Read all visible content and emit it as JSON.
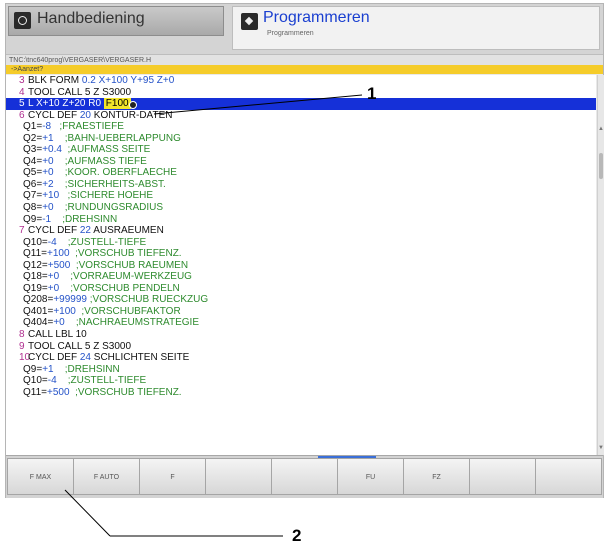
{
  "header": {
    "mode_left": {
      "label": "Handbediening",
      "icon": "manual-mode-icon"
    },
    "mode_right": {
      "label": "Programmeren",
      "sublabel": "Programmeren",
      "icon": "program-mode-icon"
    }
  },
  "pathbar": {
    "path": "TNC:\\tnc640prog\\VERGASER\\VERGASER.H"
  },
  "search": {
    "text": "->Aanzet?"
  },
  "program": {
    "l0": {
      "num": "3",
      "a": "BLK FORM ",
      "b": "0.2",
      "c": " X+100",
      "d": " Y+95",
      "e": " Z+0"
    },
    "l1": {
      "num": "4",
      "a": "TOOL CALL 5 Z S3000"
    },
    "l2": {
      "num": "5",
      "a": "L X+10 Z+20 R0 ",
      "hl": "F100"
    },
    "l3": {
      "num": "6",
      "a": "CYCL DEF ",
      "b": "20",
      "c": " KONTUR-DATEN"
    },
    "l4": {
      "a": "Q1=",
      "b": "-8",
      "c": "   ;FRAESTIEFE"
    },
    "l5": {
      "a": "Q2=",
      "b": "+1",
      "c": "    ;BAHN-UEBERLAPPUNG"
    },
    "l6": {
      "a": "Q3=",
      "b": "+0.4",
      "c": "  ;AUFMASS SEITE"
    },
    "l7": {
      "a": "Q4=",
      "b": "+0",
      "c": "    ;AUFMASS TIEFE"
    },
    "l8": {
      "a": "Q5=",
      "b": "+0",
      "c": "    ;KOOR. OBERFLAECHE"
    },
    "l9": {
      "a": "Q6=",
      "b": "+2",
      "c": "    ;SICHERHEITS-ABST."
    },
    "l10": {
      "a": "Q7=",
      "b": "+10",
      "c": "   ;SICHERE HOEHE"
    },
    "l11": {
      "a": "Q8=",
      "b": "+0",
      "c": "    ;RUNDUNGSRADIUS"
    },
    "l12": {
      "a": "Q9=",
      "b": "-1",
      "c": "    ;DREHSINN"
    },
    "l13": {
      "num": "7",
      "a": "CYCL DEF ",
      "b": "22",
      "c": " AUSRAEUMEN"
    },
    "l14": {
      "a": "Q10=",
      "b": "-4",
      "c": "    ;ZUSTELL-TIEFE"
    },
    "l15": {
      "a": "Q11=",
      "b": "+100",
      "c": "  ;VORSCHUB TIEFENZ."
    },
    "l16": {
      "a": "Q12=",
      "b": "+500",
      "c": "  ;VORSCHUB RAEUMEN"
    },
    "l17": {
      "a": "Q18=",
      "b": "+0",
      "c": "    ;VORRAEUM-WERKZEUG"
    },
    "l18": {
      "a": "Q19=",
      "b": "+0",
      "c": "    ;VORSCHUB PENDELN"
    },
    "l19": {
      "a": "Q208=",
      "b": "+99999",
      "c": " ;VORSCHUB RUECKZUG"
    },
    "l20": {
      "a": "Q401=",
      "b": "+100",
      "c": "  ;VORSCHUBFAKTOR"
    },
    "l21": {
      "a": "Q404=",
      "b": "+0",
      "c": "    ;NACHRAEUMSTRATEGIE"
    },
    "l22": {
      "num": "8",
      "a": "CALL LBL 10"
    },
    "l23": {
      "num": "9",
      "a": "TOOL CALL 5 Z S3000"
    },
    "l24": {
      "num": "10",
      "a": "CYCL DEF ",
      "b": "24",
      "c": " SCHLICHTEN SEITE"
    },
    "l25": {
      "a": "Q9=",
      "b": "+1",
      "c": "    ;DREHSINN"
    },
    "l26": {
      "a": "Q10=",
      "b": "-4",
      "c": "    ;ZUSTELL-TIEFE"
    },
    "l27": {
      "a": "Q11=",
      "b": "+500",
      "c": "  ;VORSCHUB TIEFENZ."
    }
  },
  "softkeys": {
    "s0": "F MAX",
    "s1": "F AUTO",
    "s2": "F",
    "s3": "",
    "s4": "",
    "s5": "FU",
    "s6": "FZ",
    "s7": "",
    "s8": ""
  },
  "callouts": {
    "c1": "1",
    "c2": "2"
  }
}
